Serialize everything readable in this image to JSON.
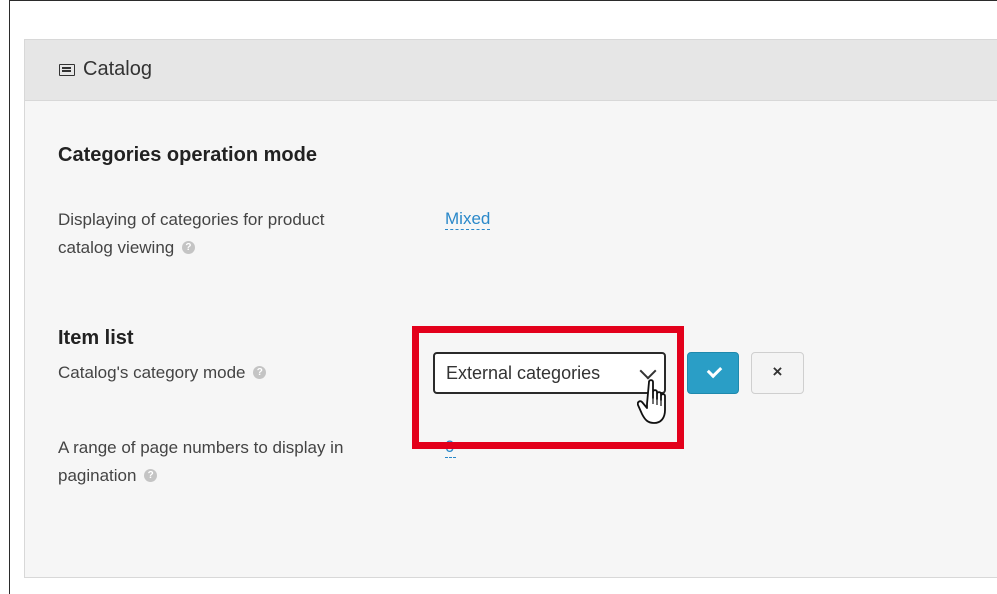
{
  "panel": {
    "title": "Catalog",
    "icon": "list-icon"
  },
  "sections": {
    "categories_mode": {
      "title": "Categories operation mode",
      "display_label_line1": "Displaying of categories for product",
      "display_label_line2": "catalog viewing",
      "display_value": "Mixed"
    },
    "item_list": {
      "title": "Item list",
      "category_mode_label": "Catalog's category mode",
      "category_mode_value": "External categories",
      "pagination_label_line1": "A range of page numbers to display in",
      "pagination_label_line2": "pagination",
      "pagination_value": "0"
    }
  },
  "icons": {
    "help": "?",
    "confirm": "check-icon",
    "cancel": "×"
  },
  "colors": {
    "accent": "#2a9ec6",
    "link": "#2a88c9",
    "highlight": "#e3001b"
  }
}
